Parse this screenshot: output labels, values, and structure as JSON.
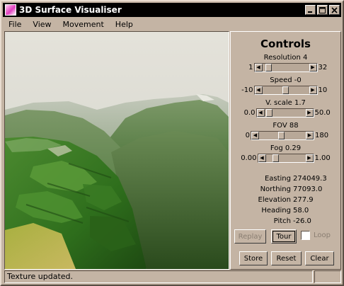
{
  "window": {
    "title": "3D Surface Visualiser"
  },
  "menu": [
    "File",
    "View",
    "Movement",
    "Help"
  ],
  "controls": {
    "title": "Controls",
    "sliders": [
      {
        "label": "Resolution 4",
        "min": "1",
        "max": "32",
        "position": 0.08
      },
      {
        "label": "Speed -0",
        "min": "-10",
        "max": "10",
        "position": 0.5
      },
      {
        "label": "V. scale 1.7",
        "min": "0.0",
        "max": "50.0",
        "position": 0.05
      },
      {
        "label": "FOV 88",
        "min": "0",
        "max": "180",
        "position": 0.49
      },
      {
        "label": "Fog 0.29",
        "min": "0.00",
        "max": "1.00",
        "position": 0.2
      }
    ],
    "readouts": [
      {
        "label": "Easting",
        "value": "274049.3"
      },
      {
        "label": "Northing",
        "value": "77093.0"
      },
      {
        "label": "Elevation",
        "value": "277.9"
      },
      {
        "label": "Heading",
        "value": "58.0"
      },
      {
        "label": "Pitch",
        "value": "-26.0"
      }
    ],
    "buttons": {
      "replay": "Replay",
      "tour": "Tour",
      "loop": "Loop",
      "store": "Store",
      "reset": "Reset",
      "clear": "Clear"
    }
  },
  "status": {
    "text": "Texture updated."
  },
  "icons": {
    "app": "app-icon",
    "minimize": "minimize-icon",
    "maximize": "maximize-icon",
    "close": "close-icon",
    "left_arrow": "left-arrow-icon",
    "right_arrow": "right-arrow-icon"
  },
  "colors": {
    "background": "#c4b4a4",
    "titlebar": "#000000",
    "disabled_text": "#8a7e72"
  }
}
